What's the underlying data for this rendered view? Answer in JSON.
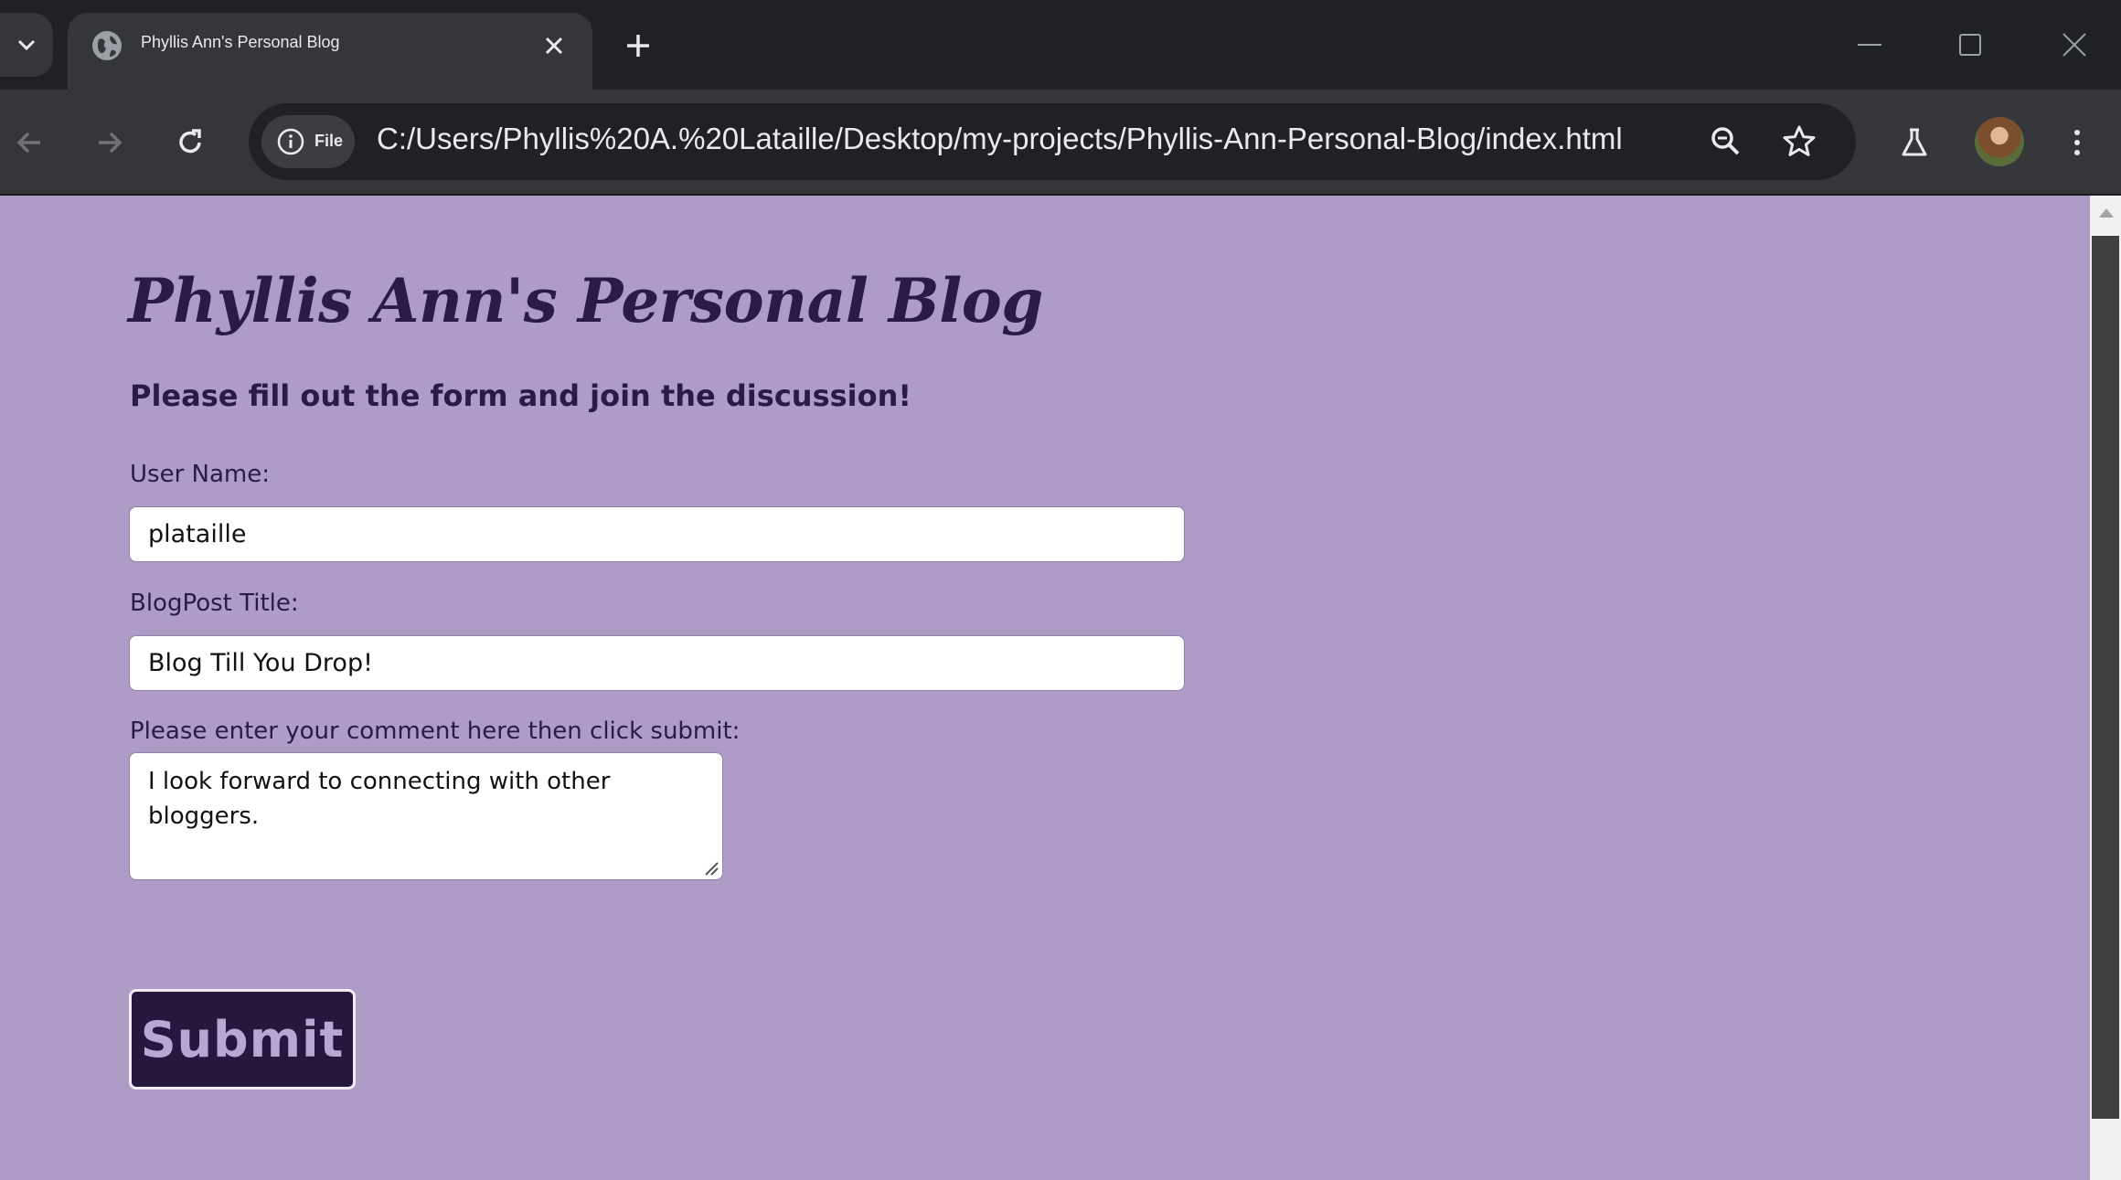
{
  "browser": {
    "tab_title": "Phyllis Ann's Personal Blog",
    "site_chip_label": "File",
    "url": "C:/Users/Phyllis%20A.%20Lataille/Desktop/my-projects/Phyllis-Ann-Personal-Blog/index.html",
    "icons": [
      "tab-search-icon",
      "globe-icon",
      "close-icon",
      "plus-icon",
      "minimize-icon",
      "maximize-icon",
      "window-close-icon",
      "back-icon",
      "forward-icon",
      "reload-icon",
      "info-icon",
      "zoom-icon",
      "star-icon",
      "labs-icon",
      "avatar",
      "more-icon"
    ]
  },
  "page": {
    "title": "Phyllis Ann's Personal Blog",
    "subtitle": "Please fill out the form and join the discussion!",
    "username_label": "User Name:",
    "username_value": "plataille",
    "blogpost_label": "BlogPost Title:",
    "blogpost_value": "Blog Till You Drop!",
    "comment_label": "Please enter your comment here then click submit:",
    "comment_value": "I look forward to connecting with other bloggers.",
    "submit_label": "Submit"
  },
  "colors": {
    "page_background": "#ae9cc6",
    "heading_text": "#2a1a45",
    "submit_background": "#26173f",
    "submit_text": "#b8a6d3"
  }
}
